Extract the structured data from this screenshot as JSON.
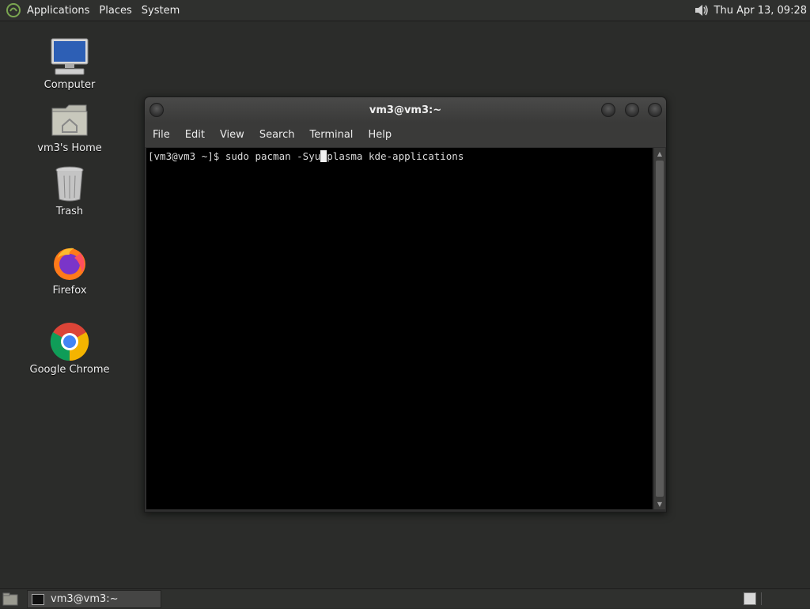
{
  "top_panel": {
    "menus": [
      "Applications",
      "Places",
      "System"
    ],
    "clock": "Thu Apr 13, 09:28",
    "logo_icon": "mate-logo-icon",
    "volume_icon": "speaker-icon"
  },
  "desktop": {
    "icons": [
      {
        "label": "Computer",
        "icon": "computer-icon"
      },
      {
        "label": "vm3's Home",
        "icon": "home-folder-icon"
      },
      {
        "label": "Trash",
        "icon": "trash-icon"
      },
      {
        "label": "Firefox",
        "icon": "firefox-icon"
      },
      {
        "label": "Google Chrome",
        "icon": "chrome-icon"
      }
    ]
  },
  "terminal": {
    "title": "vm3@vm3:~",
    "menu": [
      "File",
      "Edit",
      "View",
      "Search",
      "Terminal",
      "Help"
    ],
    "prompt": "[vm3@vm3 ~]$ ",
    "command_before_cursor": "sudo pacman -Syu",
    "command_after_cursor": "plasma kde-applications"
  },
  "bottom_panel": {
    "task_label": "vm3@vm3:~"
  },
  "colors": {
    "desktop_bg": "#2b2c2a",
    "panel_bg": "#2f302e",
    "terminal_bg": "#000000"
  }
}
